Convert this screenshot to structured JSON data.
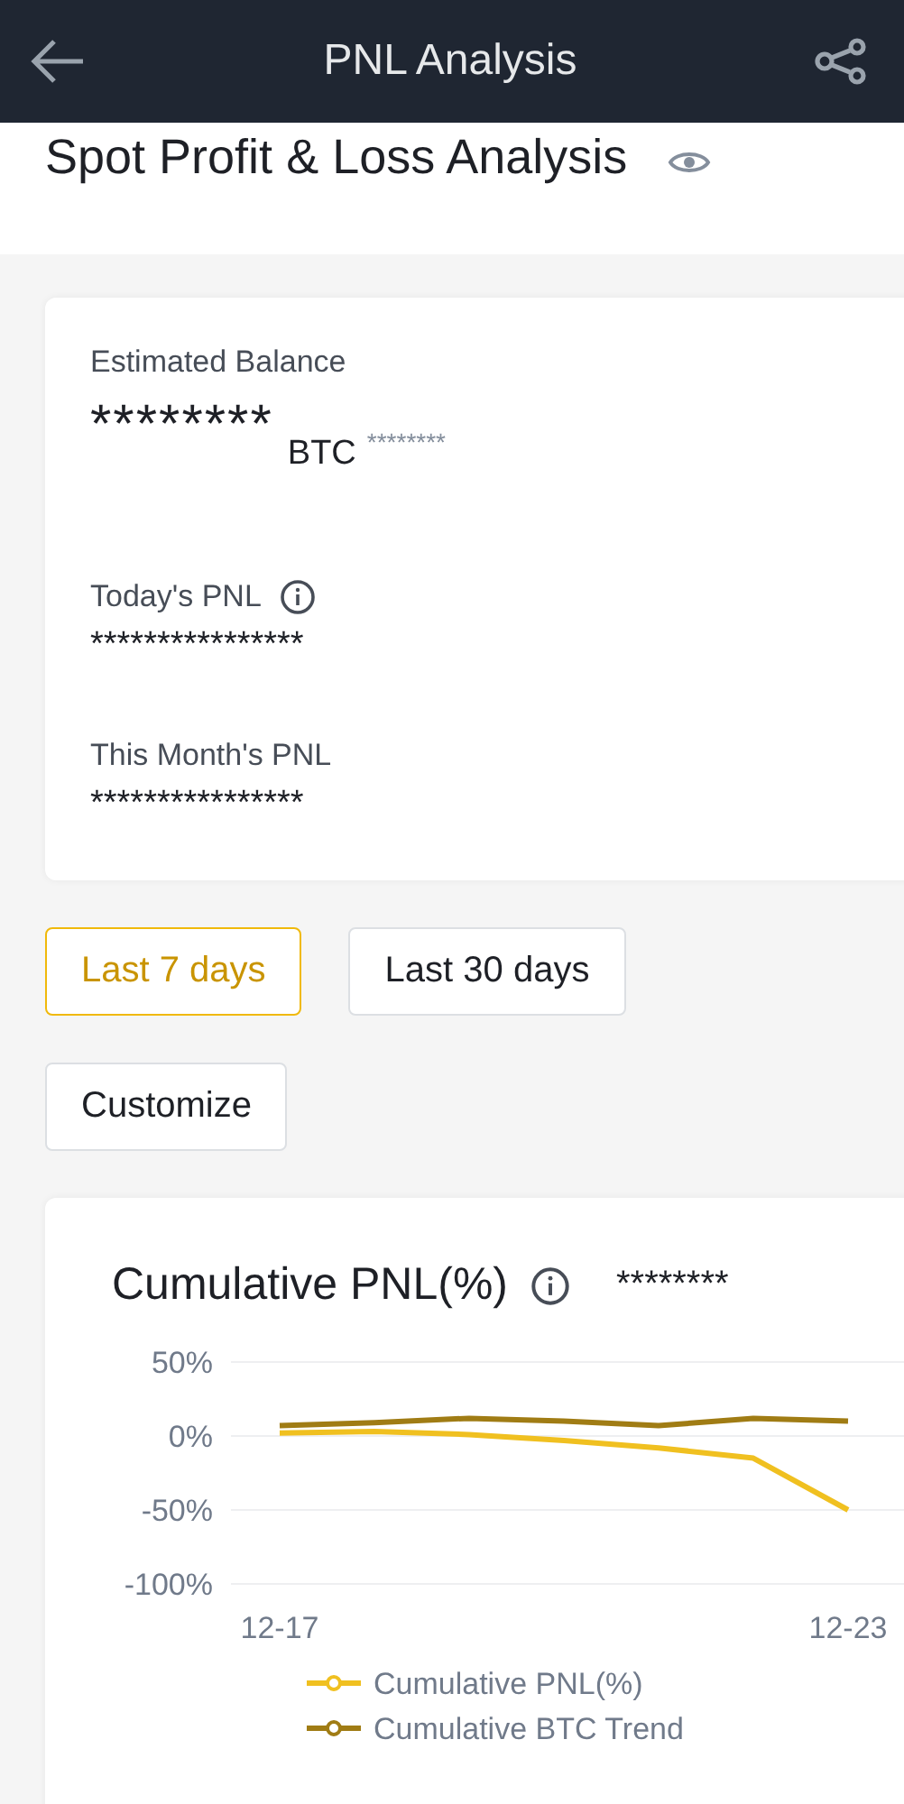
{
  "header": {
    "title": "PNL Analysis"
  },
  "page_title": "Spot Profit & Loss Analysis",
  "summary": {
    "balance_label": "Estimated Balance",
    "balance_value": "********",
    "balance_unit": "BTC",
    "balance_secondary": "********",
    "stats": [
      {
        "label": "Today's PNL",
        "info": true,
        "value": "****************"
      },
      {
        "label": "This Month's PNL",
        "info": false,
        "value": "****************"
      }
    ]
  },
  "ranges": [
    {
      "label": "Last 7 days",
      "selected": true
    },
    {
      "label": "Last 30 days",
      "selected": false
    },
    {
      "label": "Customize",
      "selected": false
    }
  ],
  "chart_card": {
    "title": "Cumulative PNL(%)",
    "value": "********",
    "chart_data": {
      "type": "line",
      "categories": [
        "12-17",
        null,
        null,
        null,
        null,
        null,
        "12-23"
      ],
      "yticks": [
        {
          "value": 50,
          "label": "50%"
        },
        {
          "value": 0,
          "label": "0%"
        },
        {
          "value": -50,
          "label": "-50%"
        },
        {
          "value": -100,
          "label": "-100%"
        }
      ],
      "ylim": [
        -100,
        50
      ],
      "legend": "bottom",
      "series": [
        {
          "name": "Cumulative PNL(%)",
          "color": "#f0c020",
          "values": [
            2,
            3,
            1,
            -3,
            -8,
            -15,
            -50
          ]
        },
        {
          "name": "Cumulative BTC Trend",
          "color": "#a07c14",
          "values": [
            7,
            9,
            12,
            10,
            7,
            12,
            10
          ]
        }
      ]
    }
  }
}
